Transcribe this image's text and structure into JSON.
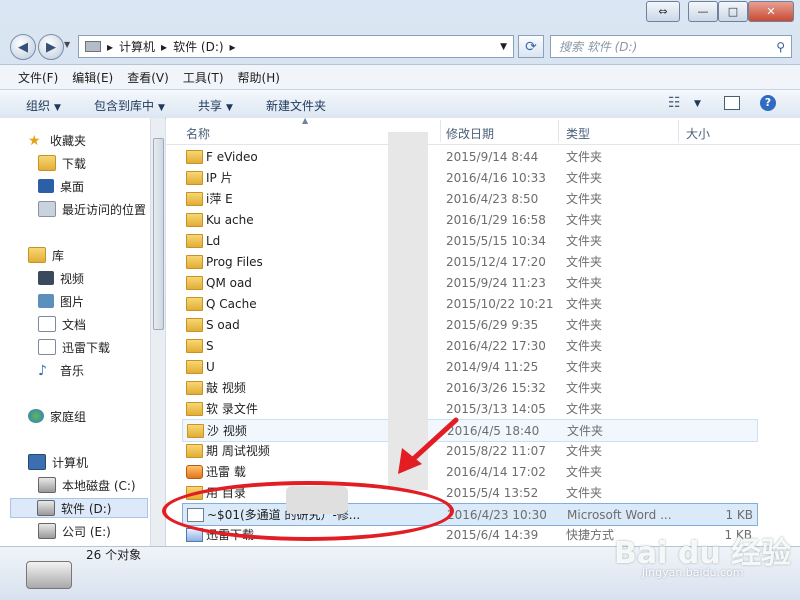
{
  "window": {
    "controls": [
      "⇔",
      "—",
      "□",
      "✕"
    ]
  },
  "address": {
    "crumbs": [
      "计算机",
      "软件 (D:)"
    ],
    "search_placeholder": "搜索 软件 (D:)"
  },
  "menu": [
    "文件(F)",
    "编辑(E)",
    "查看(V)",
    "工具(T)",
    "帮助(H)"
  ],
  "toolbar": {
    "organize": "组织",
    "include_library": "包含到库中",
    "share": "共享",
    "new_folder": "新建文件夹"
  },
  "nav": {
    "favorites": "收藏夹",
    "downloads": "下载",
    "desktop": "桌面",
    "recent": "最近访问的位置",
    "libraries": "库",
    "videos": "视频",
    "pictures": "图片",
    "documents": "文档",
    "xunlei": "迅雷下载",
    "music": "音乐",
    "homegroup": "家庭组",
    "computer": "计算机",
    "local_c": "本地磁盘 (C:)",
    "soft_d": "软件 (D:)",
    "company_e": "公司 (E:)"
  },
  "columns": {
    "name": "名称",
    "date": "修改日期",
    "type": "类型",
    "size": "大小"
  },
  "files": [
    {
      "name": "F        eVideo",
      "date": "2015/9/14 8:44",
      "type": "文件夹",
      "size": "",
      "icon": "folder"
    },
    {
      "name": "IP       片",
      "date": "2016/4/16 10:33",
      "type": "文件夹",
      "size": "",
      "icon": "folder"
    },
    {
      "name": "i萍       E",
      "date": "2016/4/23 8:50",
      "type": "文件夹",
      "size": "",
      "icon": "folder"
    },
    {
      "name": "Ku       ache",
      "date": "2016/1/29 16:58",
      "type": "文件夹",
      "size": "",
      "icon": "folder"
    },
    {
      "name": "Ld",
      "date": "2015/5/15 10:34",
      "type": "文件夹",
      "size": "",
      "icon": "folder"
    },
    {
      "name": "Prog      Files",
      "date": "2015/12/4 17:20",
      "type": "文件夹",
      "size": "",
      "icon": "folder"
    },
    {
      "name": "QM       oad",
      "date": "2015/9/24 11:23",
      "type": "文件夹",
      "size": "",
      "icon": "folder"
    },
    {
      "name": "Q        Cache",
      "date": "2015/10/22 10:21",
      "type": "文件夹",
      "size": "",
      "icon": "folder"
    },
    {
      "name": "S        oad",
      "date": "2015/6/29 9:35",
      "type": "文件夹",
      "size": "",
      "icon": "folder"
    },
    {
      "name": "S",
      "date": "2016/4/22 17:30",
      "type": "文件夹",
      "size": "",
      "icon": "folder"
    },
    {
      "name": "U",
      "date": "2014/9/4 11:25",
      "type": "文件夹",
      "size": "",
      "icon": "folder"
    },
    {
      "name": "敲       视频",
      "date": "2016/3/26 15:32",
      "type": "文件夹",
      "size": "",
      "icon": "folder"
    },
    {
      "name": "软       录文件",
      "date": "2015/3/13 14:05",
      "type": "文件夹",
      "size": "",
      "icon": "folder"
    },
    {
      "name": "沙       视频",
      "date": "2016/4/5 18:40",
      "type": "文件夹",
      "size": "",
      "icon": "folder"
    },
    {
      "name": "期       周试视频",
      "date": "2015/8/22 11:07",
      "type": "文件夹",
      "size": "",
      "icon": "folder"
    },
    {
      "name": "迅雷      载",
      "date": "2016/4/14 17:02",
      "type": "文件夹",
      "size": "",
      "icon": "app"
    },
    {
      "name": "用       目录",
      "date": "2015/5/4 13:52",
      "type": "文件夹",
      "size": "",
      "icon": "folder"
    },
    {
      "name": "~$01(多通道            的研究）-修...",
      "date": "2016/4/23 10:30",
      "type": "Microsoft Word ...",
      "size": "1 KB",
      "icon": "doc"
    },
    {
      "name": "迅雷下载",
      "date": "2015/6/4 14:39",
      "type": "快捷方式",
      "size": "1 KB",
      "icon": "lnk"
    }
  ],
  "status": {
    "count": "26 个对象"
  },
  "watermark": {
    "main": "Bai du 经验",
    "sub": "jingyan.baidu.com"
  }
}
